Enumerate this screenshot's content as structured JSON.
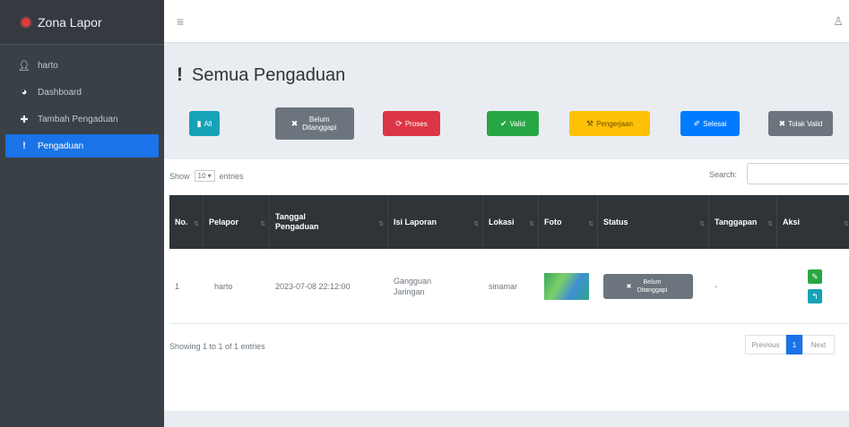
{
  "sidebar": {
    "brand": "Zona Lapor",
    "items": [
      {
        "label": "harto",
        "icon": "user-icon"
      },
      {
        "label": "Dashboard",
        "icon": "dashboard-icon"
      },
      {
        "label": "Tambah Pengaduan",
        "icon": "plus-icon"
      },
      {
        "label": "Pengaduan",
        "icon": "exclamation-icon",
        "active": true
      }
    ]
  },
  "topbar": {
    "menu_icon": "≡",
    "user_icon": "♙"
  },
  "page": {
    "title": "Semua Pengaduan"
  },
  "filters": [
    {
      "label": "All",
      "icon": "▮",
      "color": "#17a2b8"
    },
    {
      "label": "Belum Ditanggapi",
      "icon": "✖",
      "color": "#6c757d"
    },
    {
      "label": "Proses",
      "icon": "⟳",
      "color": "#dc3545"
    },
    {
      "label": "Valid",
      "icon": "✔",
      "color": "#28a745"
    },
    {
      "label": "Pengerjaan",
      "icon": "⚒",
      "color": "#ffc107"
    },
    {
      "label": "Selesai",
      "icon": "✐",
      "color": "#007bff"
    },
    {
      "label": "Tolak Valid",
      "icon": "✖",
      "color": "#6c757d"
    }
  ],
  "table": {
    "show": "Show",
    "entries_value": "10",
    "entries": "entries",
    "search_label": "Search:",
    "columns": [
      "No.",
      "Pelapor",
      "Tanggal Pengaduan",
      "Isi Laporan",
      "Lokasi",
      "Foto",
      "Status",
      "Tanggapan",
      "Aksi"
    ],
    "rows": [
      {
        "no": "1",
        "pelapor": "harto",
        "tanggal": "2023-07-08 22:12:00",
        "isi": "Gangguan Jaringan",
        "lokasi": "sinamar",
        "status": "Belum Ditanggapi",
        "tanggapan": "-"
      }
    ],
    "info": "Showing 1 to 1 of 1 entries",
    "pagination": {
      "previous": "Previous",
      "current": "1",
      "next": "Next"
    }
  },
  "colors": {
    "sidebar_bg": "#3a4047",
    "active": "#1a73e8",
    "thead_bg": "#2f3438",
    "edit": "#28a745",
    "reply": "#17a2b8"
  }
}
